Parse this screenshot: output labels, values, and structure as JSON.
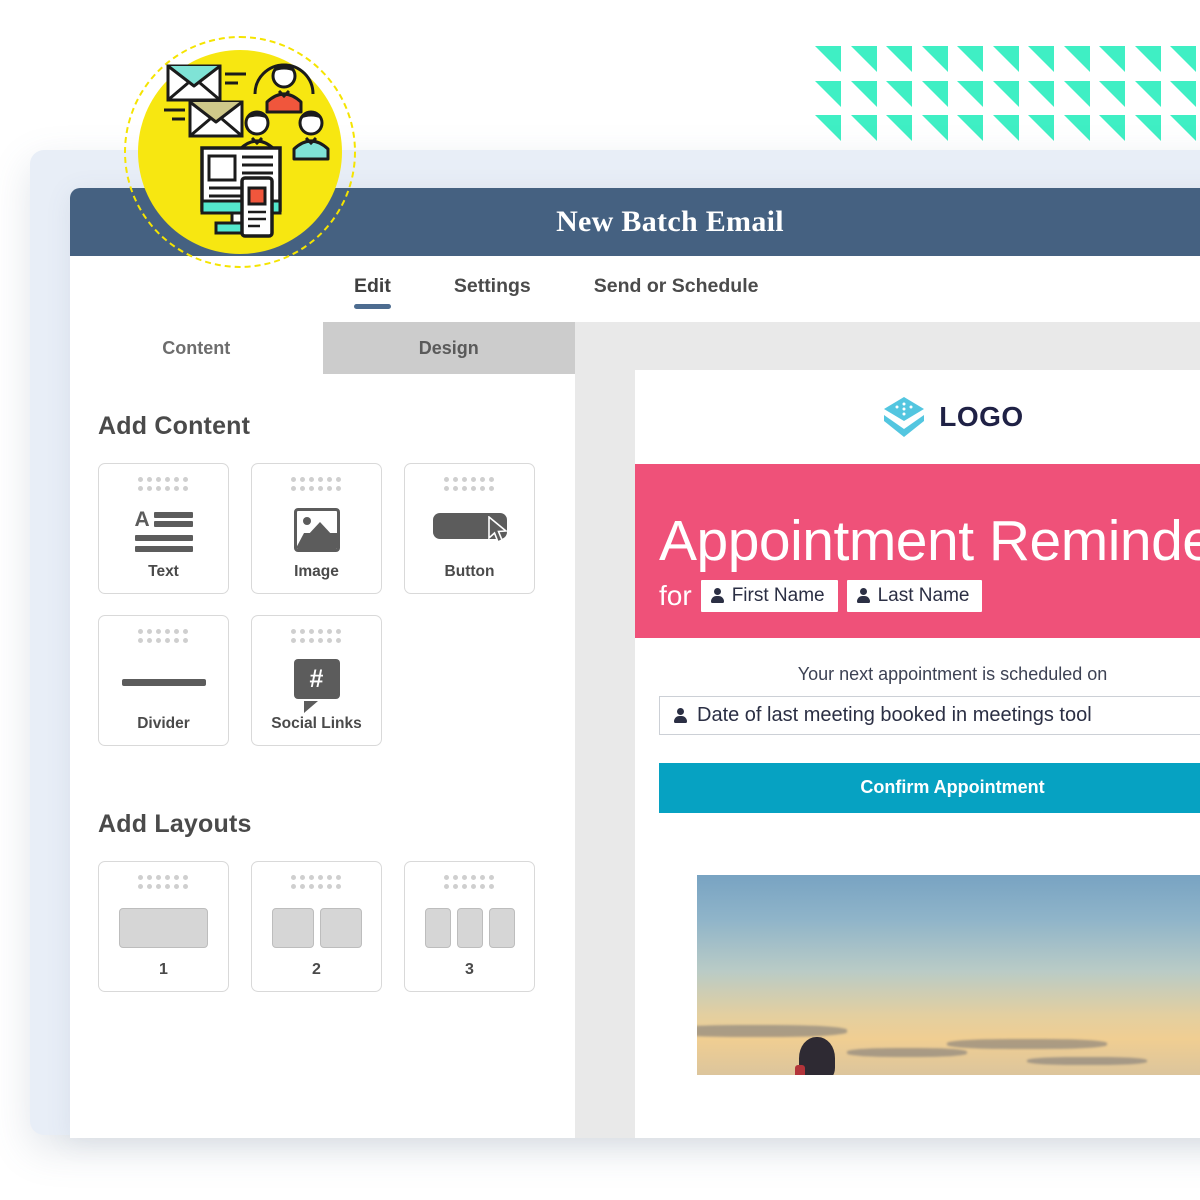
{
  "window": {
    "title": "New Batch Email"
  },
  "primary_tabs": [
    {
      "label": "Edit",
      "active": true
    },
    {
      "label": "Settings",
      "active": false
    },
    {
      "label": "Send or Schedule",
      "active": false
    }
  ],
  "sub_tabs": [
    {
      "label": "Content",
      "active": false
    },
    {
      "label": "Design",
      "active": true
    }
  ],
  "sidebar": {
    "add_content_title": "Add Content",
    "content_tiles": [
      {
        "label": "Text",
        "icon": "text-icon"
      },
      {
        "label": "Image",
        "icon": "image-icon"
      },
      {
        "label": "Button",
        "icon": "button-icon"
      },
      {
        "label": "Divider",
        "icon": "divider-icon"
      },
      {
        "label": "Social Links",
        "icon": "social-links-icon"
      }
    ],
    "add_layouts_title": "Add Layouts",
    "layout_tiles": [
      {
        "label": "1",
        "columns": 1
      },
      {
        "label": "2",
        "columns": 2
      },
      {
        "label": "3",
        "columns": 3
      }
    ]
  },
  "preview": {
    "logo_text": "LOGO",
    "hero_title": "Appointment Reminder",
    "hero_for": "for",
    "tokens": [
      {
        "label": "First Name"
      },
      {
        "label": "Last Name"
      }
    ],
    "appointment_line": "Your next appointment is scheduled on",
    "appointment_field": "Date of last meeting booked in meetings tool",
    "cta_label": "Confirm Appointment"
  },
  "colors": {
    "header_navy": "#456181",
    "hero_pink": "#EF5179",
    "cta_teal": "#06A2C2",
    "badge_yellow": "#F7E711",
    "triangle_teal": "#3FEFC4",
    "frame_blue": "#E8EEF7",
    "accent_underline": "#4D6C90",
    "logo_cyan": "#53C6E0",
    "logo_navy": "#1F2145"
  }
}
